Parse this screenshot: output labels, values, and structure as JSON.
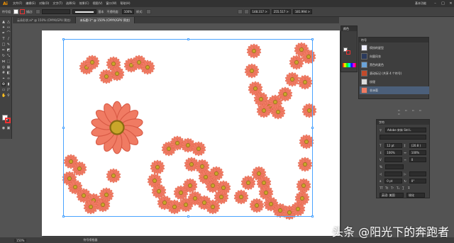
{
  "app": {
    "logo": "Ai"
  },
  "menu": [
    "文件(F)",
    "编辑(E)",
    "对象(O)",
    "文字(T)",
    "选择(S)",
    "效果(C)",
    "视图(V)",
    "窗口(W)",
    "帮助(H)"
  ],
  "workspace": "基本功能",
  "window_controls": [
    "–",
    "□",
    "✕"
  ],
  "controlbar": {
    "label": "符号组",
    "mode": "描边:",
    "stroke_style": "基本",
    "opacity_label": "不透明度:",
    "opacity": "100%",
    "style_label": "样式:",
    "x": "148.317 >",
    "y": "255.517 >",
    "w": "181.994 >"
  },
  "tabs": [
    {
      "label": "云朵形状.ai* @ 150% (CMYK/GPU 预览)"
    },
    {
      "label": "未标题-1* @ 150% (CMYK/GPU 预览)"
    }
  ],
  "status": {
    "zoom": "150%",
    "tool": "符号喷枪器"
  },
  "color_panel": {
    "title": "颜色"
  },
  "symbol_panel": {
    "title": "符号",
    "items": [
      "缤纷的星型",
      "向量风衣",
      "黑色的麦色",
      "滚动标记 (共享 4 个符号)",
      "纹理",
      "非洲菊"
    ],
    "selected_index": 5
  },
  "char_panel": {
    "title": "字符",
    "font": "Adobe 宋体 Std L",
    "size": "12 pt",
    "leading": "(20.8 )",
    "tracking": "0",
    "scale_v": "100%",
    "scale_h": "100%",
    "baseline": "0 pt",
    "rotation": "0°",
    "language": "英语: 美国",
    "aa": "锐化"
  },
  "watermark": "头条 @阳光下的奔跑者",
  "colors": {
    "petal": "#f07b63",
    "petal_dark": "#d85a45",
    "center": "#c9a62a",
    "center_ring": "#8a6b12",
    "selection": "#4aa3ff"
  }
}
